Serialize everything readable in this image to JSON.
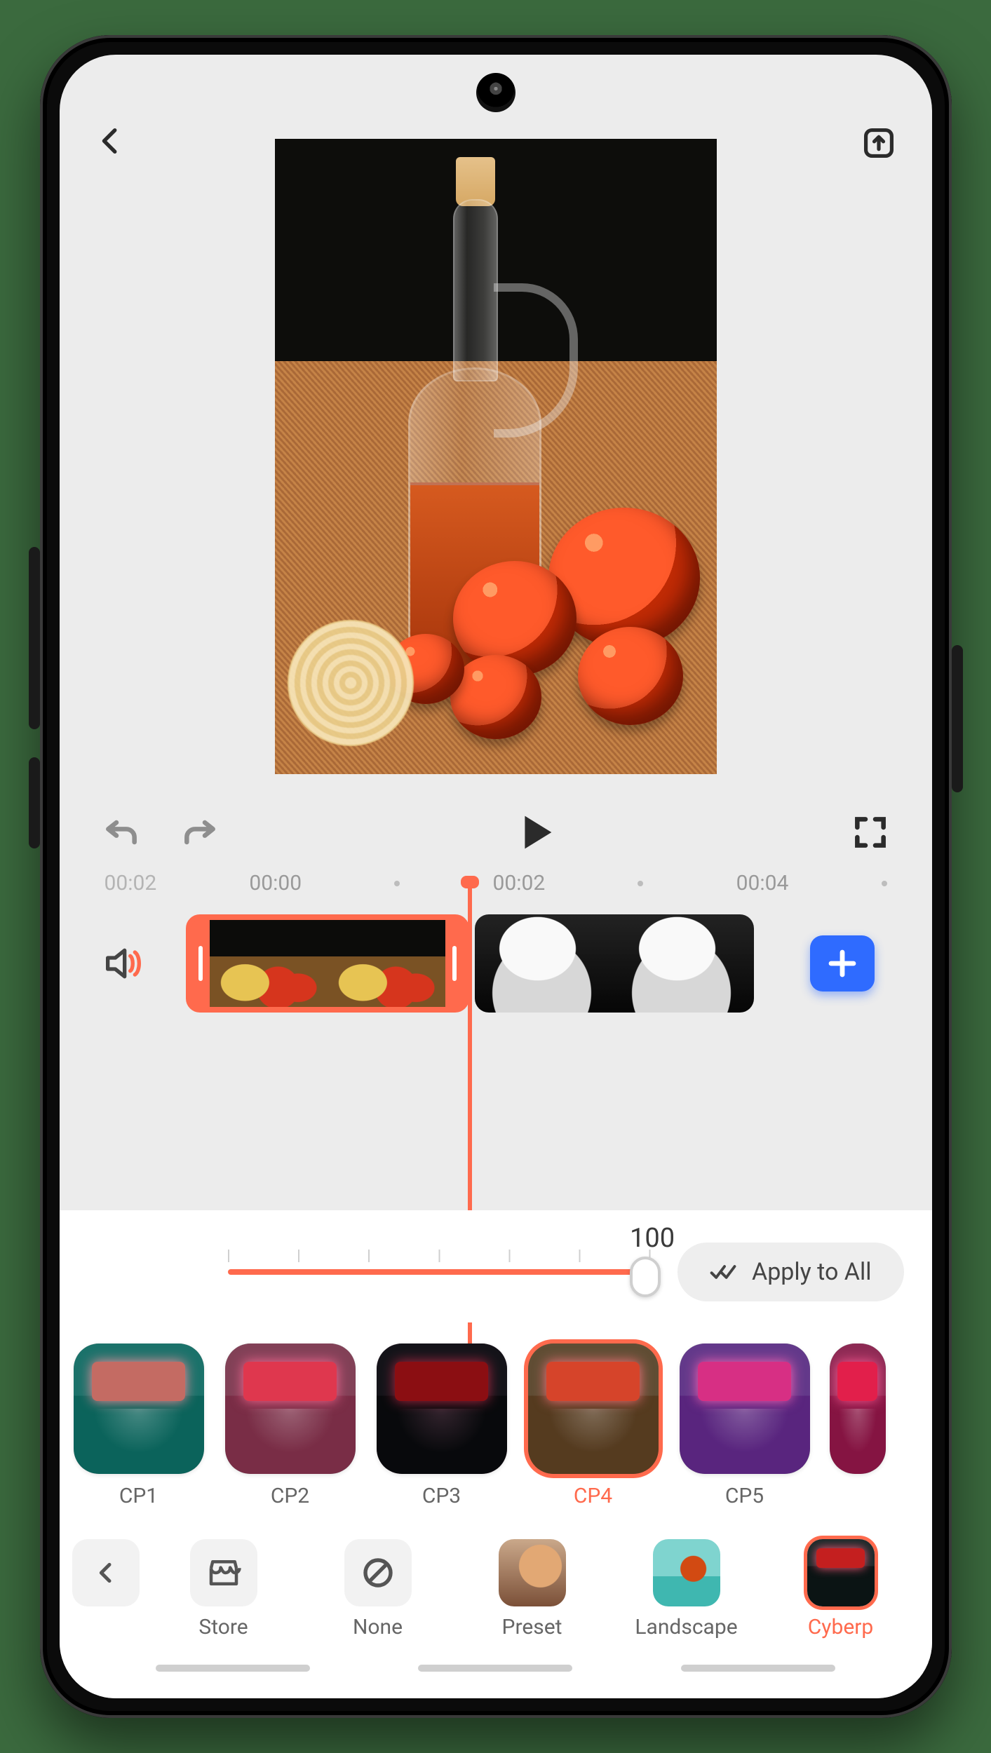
{
  "timeline": {
    "current_label": "00:02",
    "markers": [
      "00:00",
      "00:02",
      "00:04"
    ]
  },
  "intensity": {
    "value": "100",
    "apply_all_label": "Apply to All"
  },
  "filters": {
    "items": [
      {
        "label": "CP1"
      },
      {
        "label": "CP2"
      },
      {
        "label": "CP3"
      },
      {
        "label": "CP4"
      },
      {
        "label": "CP5"
      }
    ],
    "active_index": 3
  },
  "categories": {
    "items": [
      {
        "label": "Store"
      },
      {
        "label": "None"
      },
      {
        "label": "Preset"
      },
      {
        "label": "Landscape"
      },
      {
        "label": "Cyberp"
      }
    ],
    "active_index": 4
  },
  "accent_color": "#ff6a4d"
}
